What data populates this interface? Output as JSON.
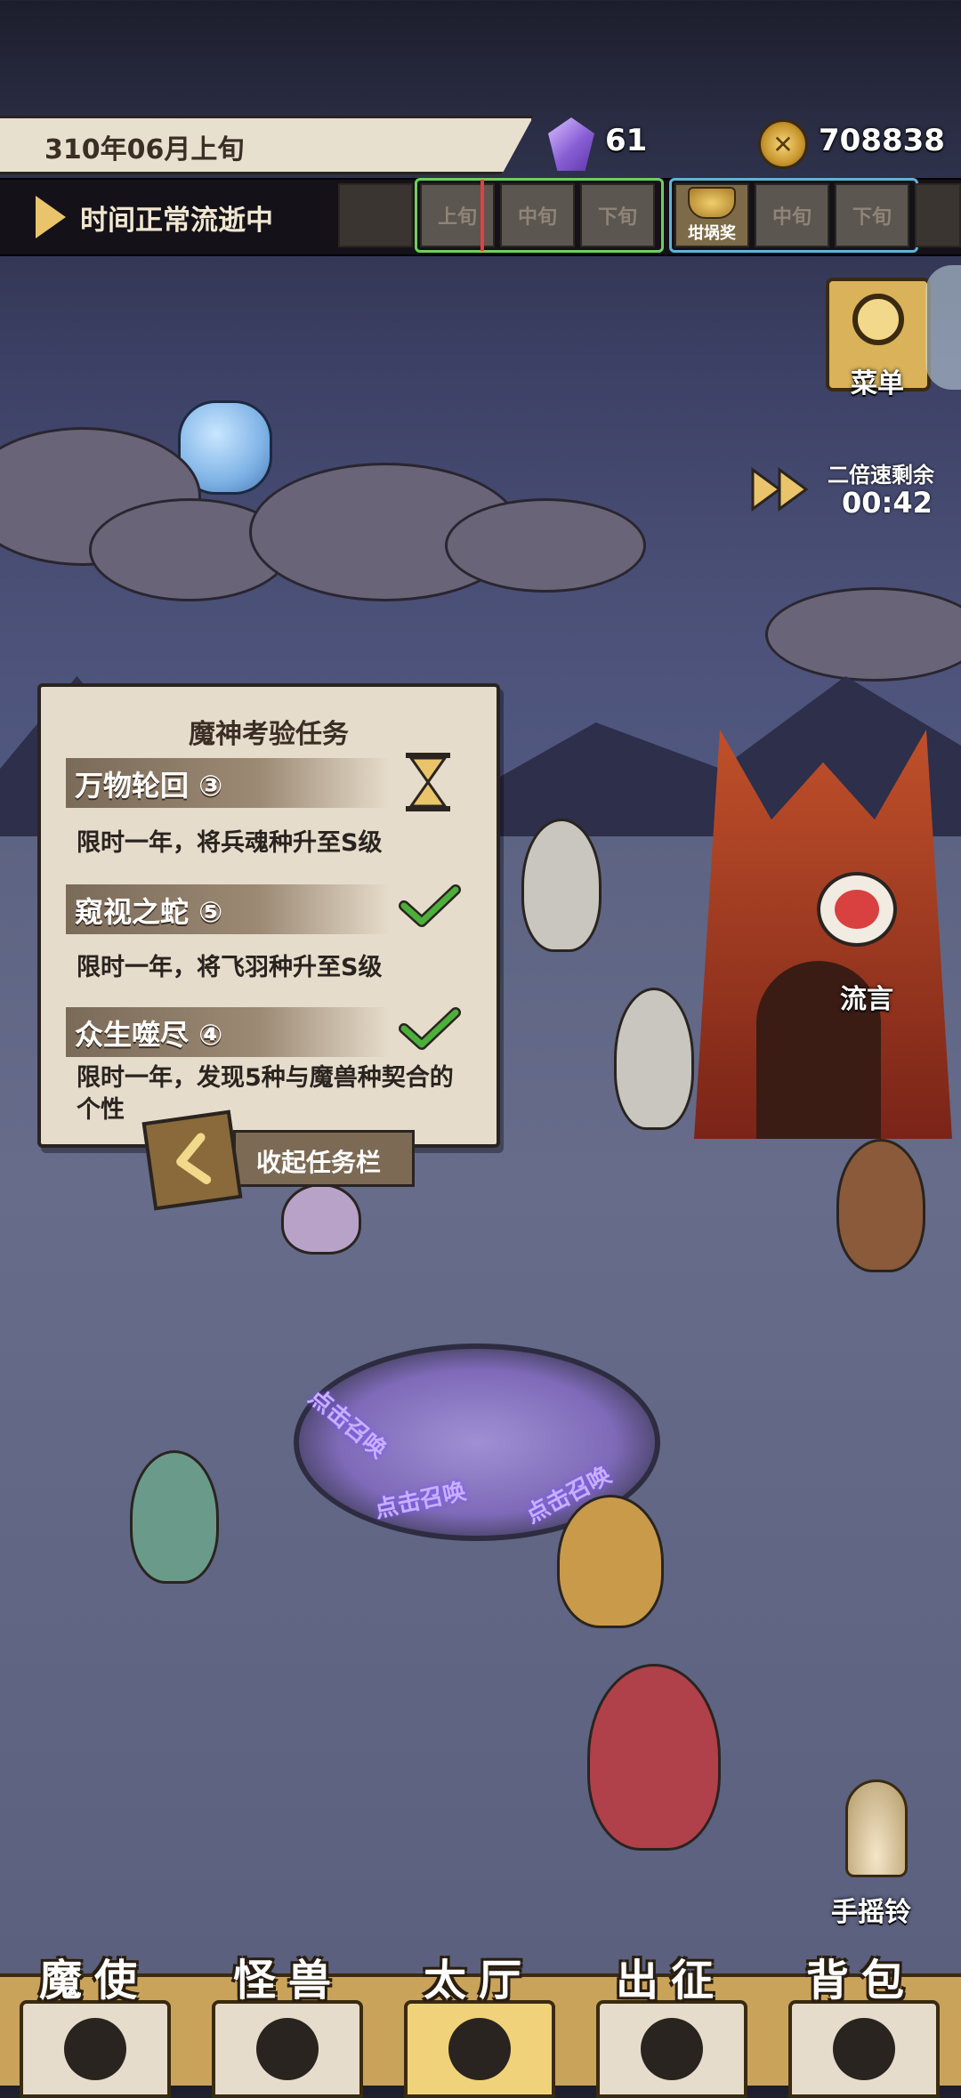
{
  "header": {
    "date": "310年06月上旬",
    "gems": "61",
    "coins": "708838",
    "gem_icon": "purple-crystal-icon",
    "coin_icon": "gold-coin-icon"
  },
  "timebar": {
    "status": "时间正常流逝中",
    "slots_current": [
      "上旬",
      "中旬",
      "下旬"
    ],
    "slots_next": [
      "中旬",
      "下旬"
    ],
    "prize_label": "坩埚奖"
  },
  "menu": {
    "label": "菜单"
  },
  "speed": {
    "label": "二倍速剩余",
    "time": "00:42"
  },
  "quest_panel": {
    "title": "魔神考验任务",
    "quests": [
      {
        "name": "万物轮回 ③",
        "desc": "限时一年，将兵魂种升至S级",
        "status": "in-progress"
      },
      {
        "name": "窥视之蛇 ⑤",
        "desc": "限时一年，将飞羽种升至S级",
        "status": "done"
      },
      {
        "name": "众生噬尽 ④",
        "desc": "限时一年，发现5种与魔兽种契合的个性",
        "status": "done"
      }
    ],
    "collapse_label": "收起任务栏"
  },
  "scene": {
    "rumor_label": "流言",
    "summon_text": "点击召唤",
    "bell_label": "手摇铃"
  },
  "nav": {
    "items": [
      {
        "label": "魔使",
        "icon": "skull-icon"
      },
      {
        "label": "怪兽",
        "icon": "monster-icon"
      },
      {
        "label": "太厅",
        "icon": "hall-icon"
      },
      {
        "label": "出征",
        "icon": "expedition-icon"
      },
      {
        "label": "背包",
        "icon": "backpack-icon"
      }
    ],
    "active": 2
  },
  "colors": {
    "accent_gold": "#d9b25a",
    "check_green": "#4caf3a",
    "panel_bg": "#e6dccb"
  }
}
